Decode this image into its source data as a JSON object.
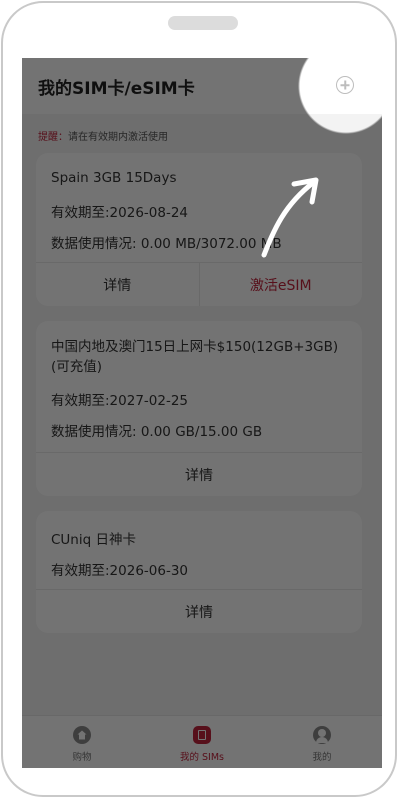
{
  "header": {
    "title": "我的SIM卡/eSIM卡"
  },
  "reminder": {
    "label": "提醒：",
    "text": "请在有效期内激活使用"
  },
  "cards": [
    {
      "title": "Spain 3GB 15Days",
      "validity": "有效期至:2026-08-24",
      "usage": "数据使用情况: 0.00 MB/3072.00 MB",
      "details_label": "详情",
      "activate_label": "激活eSIM"
    },
    {
      "title": "中国内地及澳门15日上网卡$150(12GB+3GB)(可充值)",
      "validity": "有效期至:2027-02-25",
      "usage": "数据使用情况: 0.00 GB/15.00 GB",
      "details_label": "详情"
    },
    {
      "title": "CUniq 日神卡",
      "validity": "有效期至:2026-06-30",
      "details_label": "详情"
    }
  ],
  "tabs": [
    {
      "label": "购物",
      "icon": "home-icon"
    },
    {
      "label": "我的 SIMs",
      "icon": "sim-icon",
      "active": true
    },
    {
      "label": "我的",
      "icon": "user-icon"
    }
  ],
  "colors": {
    "accent": "#c0243c",
    "overlay": "rgba(0,0,0,0.55)"
  }
}
